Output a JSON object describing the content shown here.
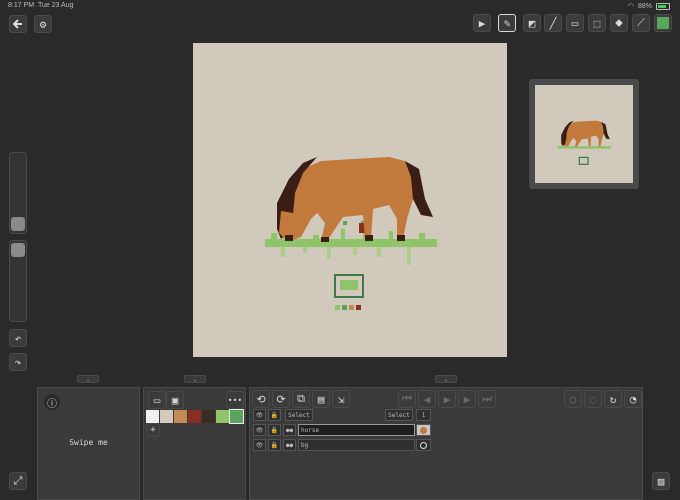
{
  "status": {
    "time": "8:17 PM",
    "date": "Tue 23 Aug",
    "battery": "88%"
  },
  "toolbar": {
    "back_icon": "back-arrow-icon",
    "settings_icon": "gear-icon",
    "tools": [
      "select-icon",
      "pencil-icon",
      "fill-icon",
      "line-icon",
      "rect-icon",
      "marquee-icon",
      "bucket-icon",
      "eyedropper-icon"
    ],
    "current_color": "#5aa55e"
  },
  "colors": {
    "canvas_bg": "#d2c9bd",
    "horse_brown": "#c17a3b",
    "dark": "#3a1d14",
    "grass": "#8fc46b"
  },
  "info_panel": {
    "text": "Swipe me"
  },
  "palette": {
    "colors": [
      "#f0f0f0",
      "#d4c9bd",
      "#c48a55",
      "#8b2e22",
      "#3b2b26",
      "#8fc46b",
      "#5aa55e"
    ],
    "more_label": "•••"
  },
  "layers": {
    "select_left": "Select",
    "select_right": "Select",
    "count": "1",
    "items": [
      {
        "name": "horse",
        "selected": true
      },
      {
        "name": "bg",
        "selected": false
      }
    ]
  }
}
